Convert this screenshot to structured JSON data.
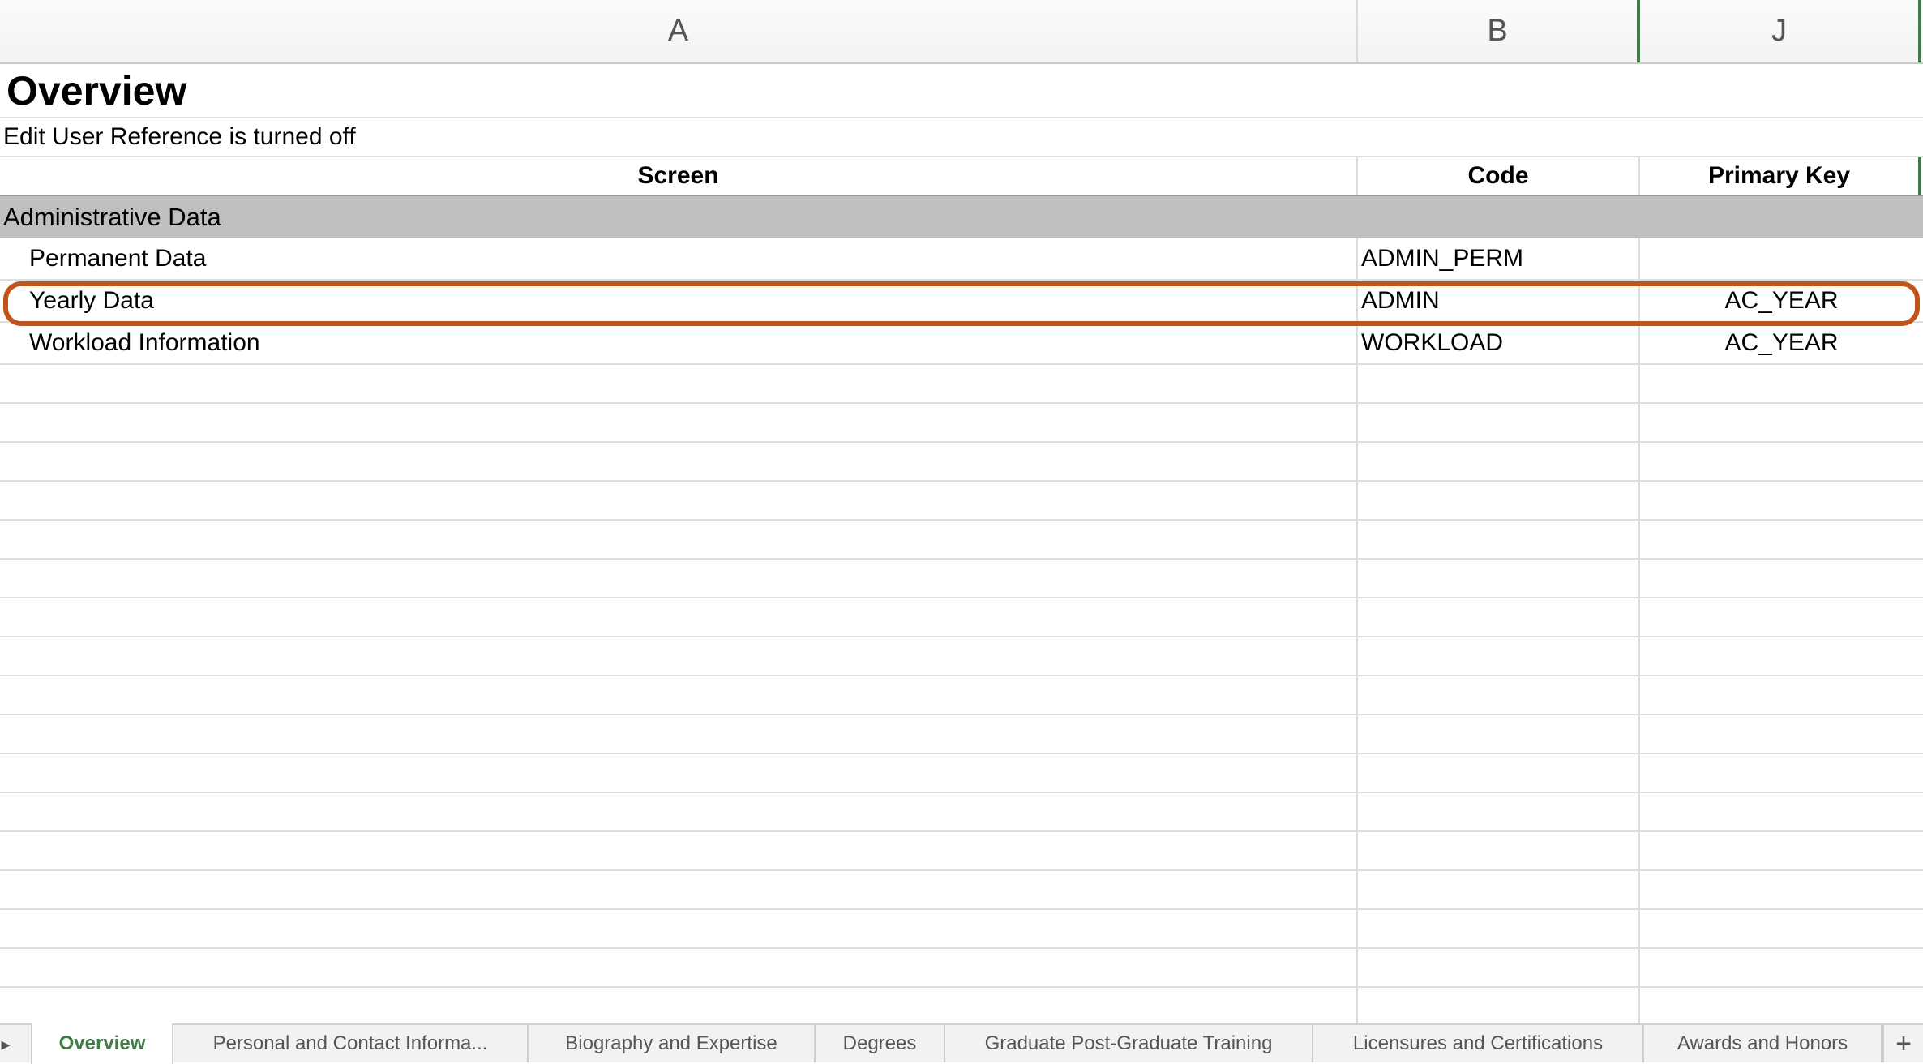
{
  "columns": [
    "A",
    "B",
    "J"
  ],
  "title": "Overview",
  "note": "Edit User Reference is turned off",
  "headers": {
    "screen": "Screen",
    "code": "Code",
    "primary_key": "Primary Key"
  },
  "group": "Administrative Data",
  "rows": [
    {
      "screen": "Permanent Data",
      "code": "ADMIN_PERM",
      "primary_key": ""
    },
    {
      "screen": "Yearly Data",
      "code": "ADMIN",
      "primary_key": "AC_YEAR"
    },
    {
      "screen": "Workload Information",
      "code": "WORKLOAD",
      "primary_key": "AC_YEAR"
    }
  ],
  "highlight_color": "#c0541a",
  "accent_color": "#3f7d45",
  "tabs": [
    "Overview",
    "Personal and Contact Informa...",
    "Biography and Expertise",
    "Degrees",
    "Graduate Post-Graduate Training",
    "Licensures and Certifications",
    "Awards and Honors"
  ],
  "active_tab": "Overview",
  "icons": {
    "prev_sheet": "triangle-right-icon",
    "add_sheet": "plus-icon"
  }
}
